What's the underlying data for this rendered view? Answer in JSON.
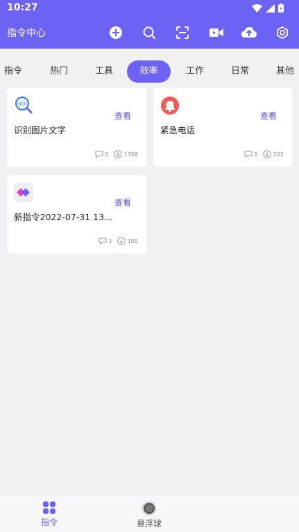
{
  "status_bar": {
    "time": "10:27",
    "icons": [
      "wifi-icon",
      "signal-icon",
      "battery-icon"
    ]
  },
  "header": {
    "title": "指令中心",
    "actions": [
      "add-icon",
      "search-icon",
      "scan-icon",
      "video-icon",
      "upload-cloud-icon",
      "settings-icon"
    ]
  },
  "tabs": [
    {
      "label": "指令"
    },
    {
      "label": "热门"
    },
    {
      "label": "工具"
    },
    {
      "label": "效率",
      "active": true
    },
    {
      "label": "工作"
    },
    {
      "label": "日常"
    },
    {
      "label": "其他"
    }
  ],
  "cards": [
    {
      "icon": "ocr-magnifier-icon",
      "view": "查看",
      "name": "识别图片文字",
      "comments": "0",
      "downloads": "1358"
    },
    {
      "icon": "alarm-bell-icon",
      "view": "查看",
      "name": "紧急电话",
      "comments": "0",
      "downloads": "202"
    },
    {
      "icon": "app-logo-icon",
      "view": "查看",
      "name": "新指令2022-07-31 13...",
      "comments": "1",
      "downloads": "100"
    }
  ],
  "bottom_nav": [
    {
      "label": "指令",
      "icon": "grid-icon",
      "active": true
    },
    {
      "label": "悬浮球",
      "icon": "floating-ball-icon",
      "active": false
    }
  ],
  "colors": {
    "primary": "#6c63f5",
    "link": "#5a54d8",
    "background": "#f1f1f4",
    "bell": "#ef5b5b"
  }
}
